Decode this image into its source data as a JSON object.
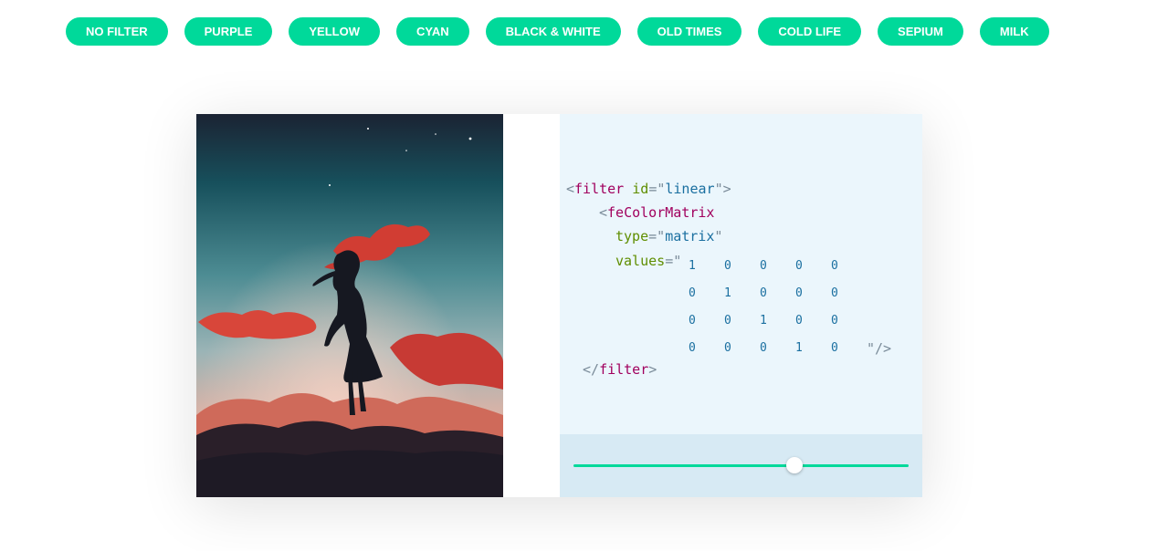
{
  "filters": [
    {
      "label": "NO FILTER"
    },
    {
      "label": "PURPLE"
    },
    {
      "label": "YELLOW"
    },
    {
      "label": "CYAN"
    },
    {
      "label": "BLACK & WHITE"
    },
    {
      "label": "OLD TIMES"
    },
    {
      "label": "COLD LIFE"
    },
    {
      "label": "SEPIUM"
    },
    {
      "label": "MILK"
    }
  ],
  "code": {
    "filter_tag": "filter",
    "id_attr": "id",
    "id_value": "linear",
    "matrix_tag": "feColorMatrix",
    "type_attr": "type",
    "type_value": "matrix",
    "values_attr": "values",
    "matrix": [
      [
        "1",
        "0",
        "0",
        "0",
        "0"
      ],
      [
        "0",
        "1",
        "0",
        "0",
        "0"
      ],
      [
        "0",
        "0",
        "1",
        "0",
        "0"
      ],
      [
        "0",
        "0",
        "0",
        "1",
        "0"
      ]
    ]
  },
  "slider": {
    "value": 0.66
  },
  "colors": {
    "accent": "#00d99a",
    "code_bg": "#ebf6fc",
    "slider_bg": "#d7eaf4"
  }
}
